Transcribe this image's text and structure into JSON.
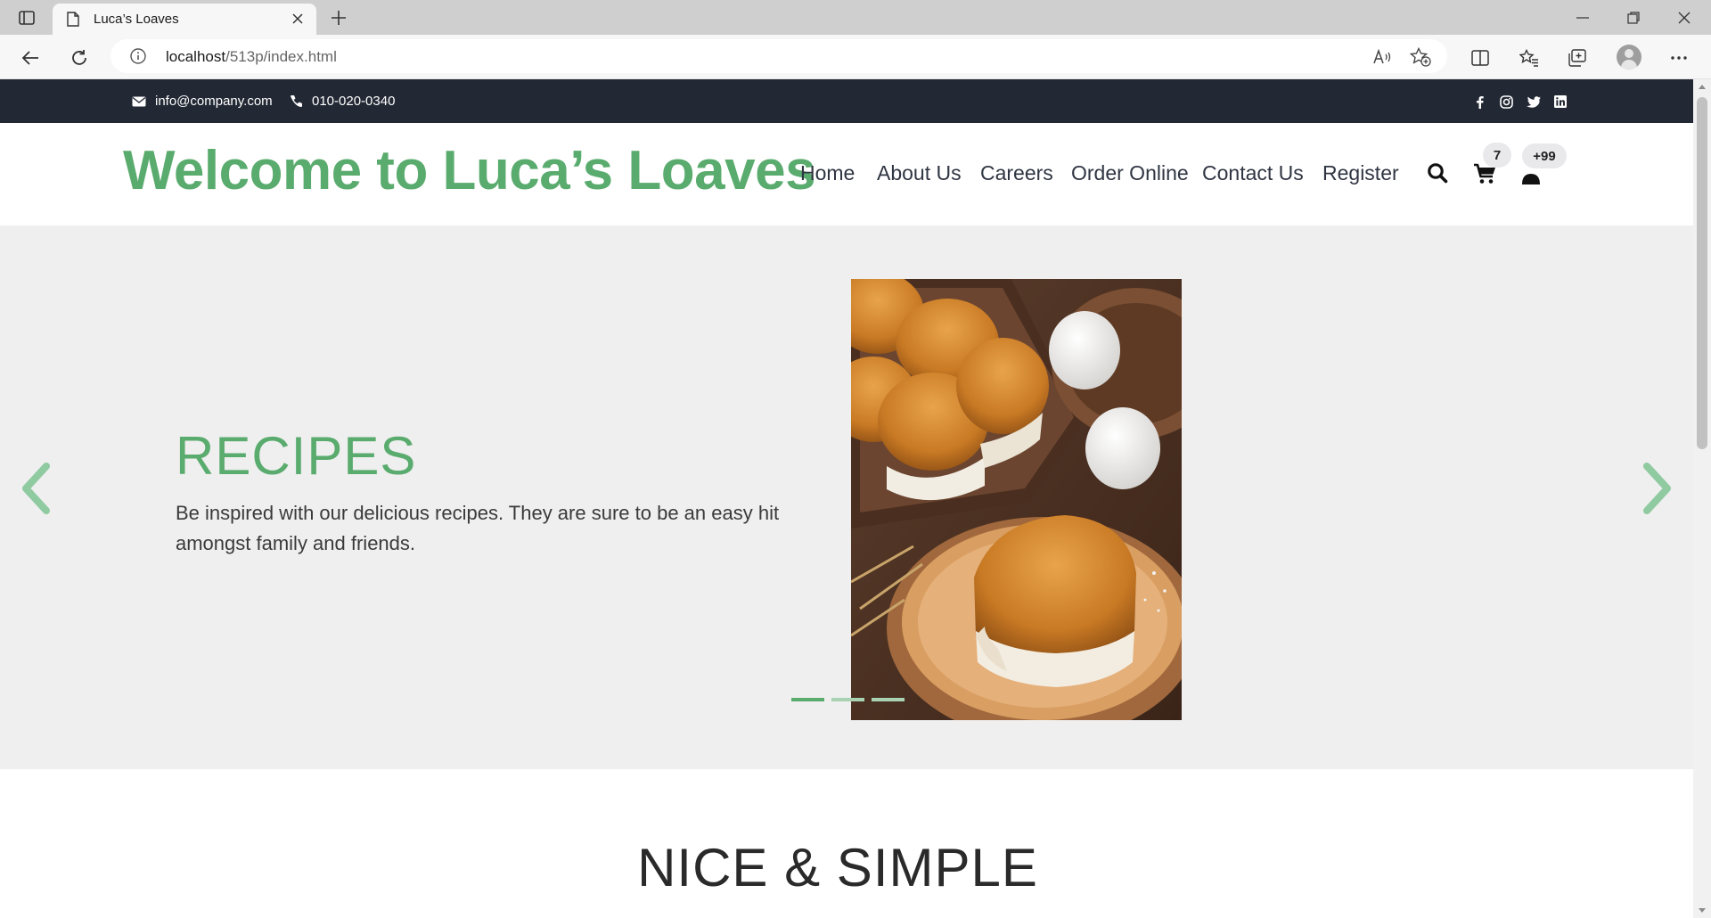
{
  "browser": {
    "tab_title": "Luca’s Loaves",
    "url_host": "localhost",
    "url_path": "/513p/index.html"
  },
  "topbar": {
    "email": "info@company.com",
    "phone": "010-020-0340",
    "social_icons": [
      "facebook-icon",
      "instagram-icon",
      "twitter-icon",
      "linkedin-icon"
    ]
  },
  "header": {
    "brand": "Welcome to Luca’s Loaves",
    "nav": [
      "Home",
      "About Us",
      "Careers",
      "Order Online",
      "Contact Us",
      "Register"
    ],
    "cart_count": "7",
    "user_count": "+99"
  },
  "hero": {
    "title": "RECIPES",
    "description": "Be inspired with our delicious recipes. They are sure to be an easy hit amongst family and friends.",
    "slide_count": 3,
    "active_slide": 1
  },
  "section": {
    "title": "NICE & SIMPLE"
  },
  "colors": {
    "accent": "#5aab6e",
    "topbar": "#222834",
    "hero_bg": "#efefef"
  }
}
